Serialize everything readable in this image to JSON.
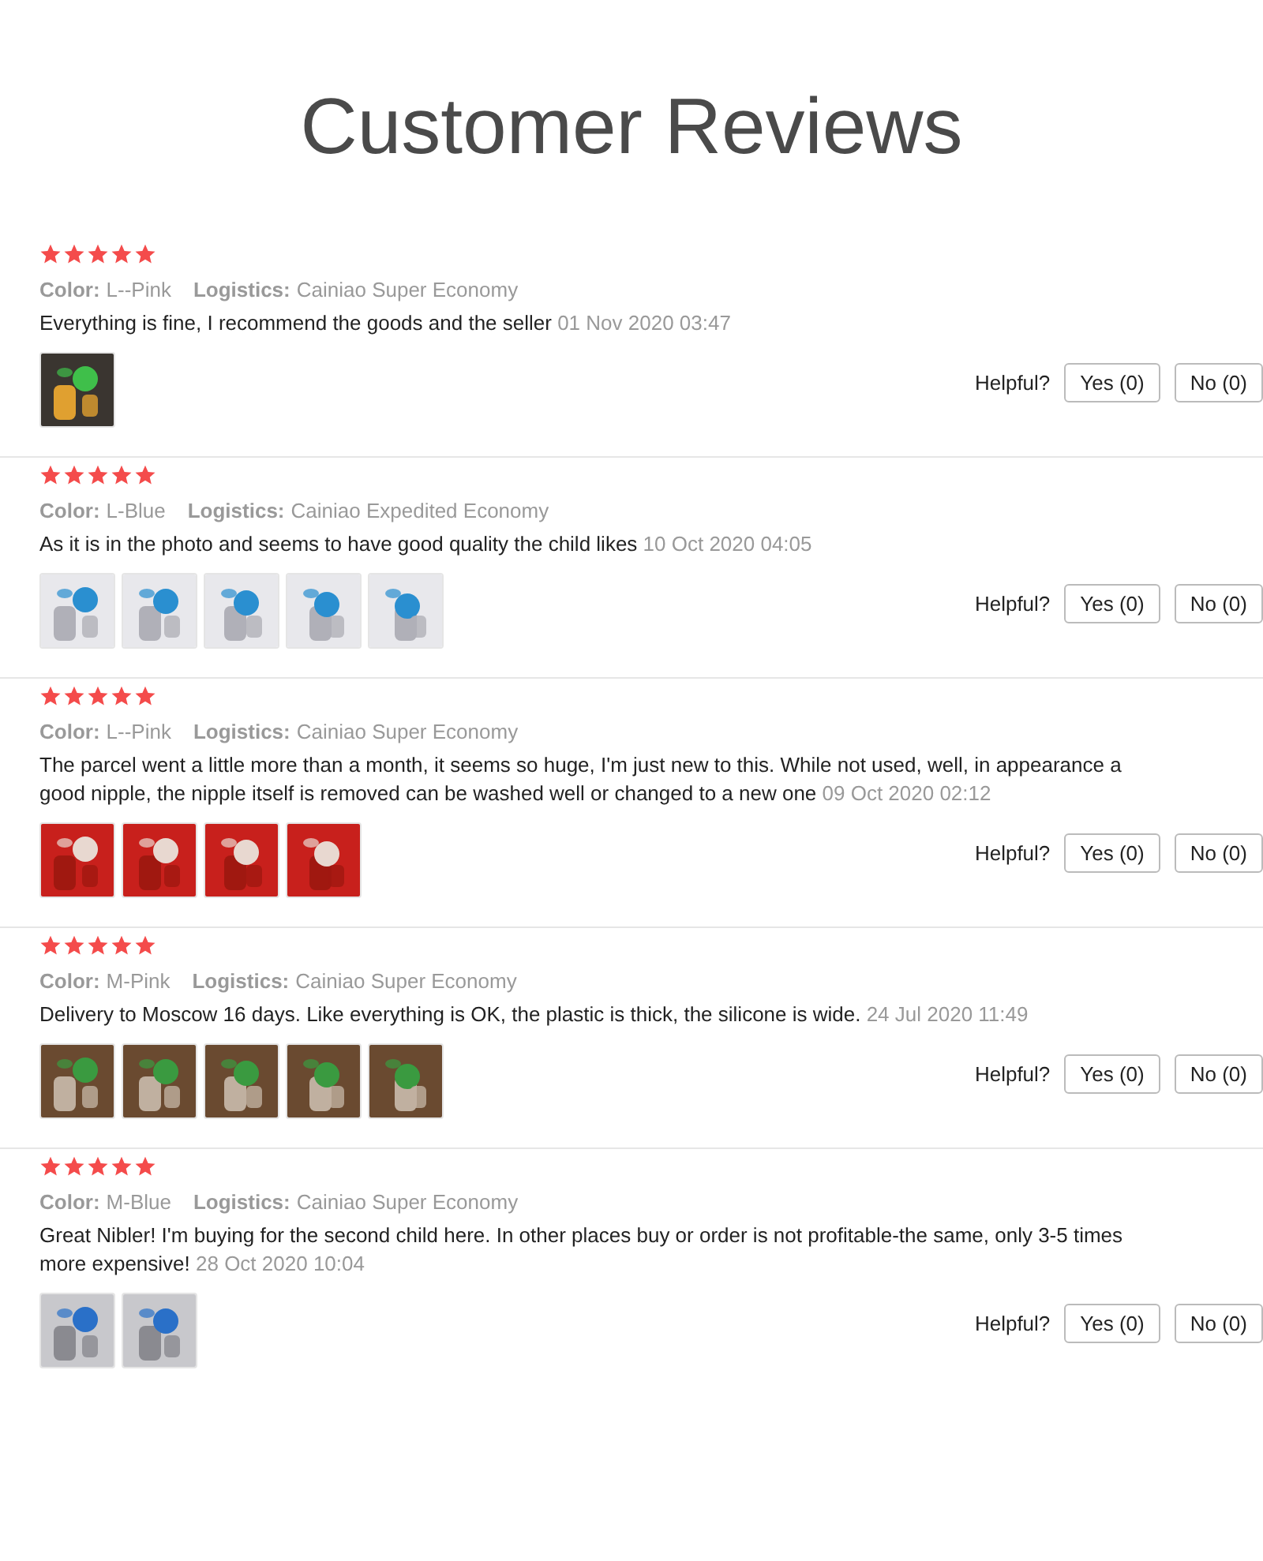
{
  "title": "Customer Reviews",
  "reviews": [
    {
      "stars": 5,
      "color_label": "Color:",
      "variant": "L--Pink",
      "logistics_label": "Logistics:",
      "logistics": "Cainiao Super Economy",
      "comment": "Everything is fine, I recommend the goods and the seller",
      "date": "01 Nov 2020 03:47",
      "photos": [
        {
          "kind": "picture"
        }
      ],
      "helpful_label": "Helpful?",
      "yes": "Yes (0)",
      "no": "No (0)"
    },
    {
      "stars": 5,
      "color_label": "Color:",
      "variant": "L-Blue",
      "logistics_label": "Logistics:",
      "logistics": "Cainiao Expedited Economy",
      "comment": "As it is in the photo and seems to have good quality the child likes",
      "date": "10 Oct 2020 04:05",
      "photos": [
        {
          "kind": "picture"
        },
        {
          "kind": "picture"
        },
        {
          "kind": "picture"
        },
        {
          "kind": "picture"
        },
        {
          "kind": "picture"
        }
      ],
      "helpful_label": "Helpful?",
      "yes": "Yes (0)",
      "no": "No (0)"
    },
    {
      "stars": 5,
      "color_label": "Color:",
      "variant": "L--Pink",
      "logistics_label": "Logistics:",
      "logistics": "Cainiao Super Economy",
      "comment": "The parcel went a little more than a month, it seems so huge, I'm just new to this. While not used, well, in appearance a good nipple, the nipple itself is removed can be washed well or changed to a new one",
      "date": "09 Oct 2020 02:12",
      "photos": [
        {
          "kind": "picture"
        },
        {
          "kind": "picture"
        },
        {
          "kind": "picture"
        },
        {
          "kind": "picture"
        }
      ],
      "helpful_label": "Helpful?",
      "yes": "Yes (0)",
      "no": "No (0)"
    },
    {
      "stars": 5,
      "color_label": "Color:",
      "variant": "M-Pink",
      "logistics_label": "Logistics:",
      "logistics": "Cainiao Super Economy",
      "comment": "Delivery to Moscow 16 days. Like everything is OK, the plastic is thick, the silicone is wide.",
      "date": "24 Jul 2020 11:49",
      "photos": [
        {
          "kind": "picture"
        },
        {
          "kind": "picture"
        },
        {
          "kind": "picture"
        },
        {
          "kind": "picture"
        },
        {
          "kind": "picture"
        }
      ],
      "helpful_label": "Helpful?",
      "yes": "Yes (0)",
      "no": "No (0)"
    },
    {
      "stars": 5,
      "color_label": "Color:",
      "variant": "M-Blue",
      "logistics_label": "Logistics:",
      "logistics": "Cainiao Super Economy",
      "comment": "Great Nibler! I'm buying for the second child here. In other places buy or order is not profitable-the same, only 3-5 times more expensive!",
      "date": "28 Oct 2020 10:04",
      "photos": [
        {
          "kind": "picture"
        },
        {
          "kind": "picture"
        }
      ],
      "helpful_label": "Helpful?",
      "yes": "Yes (0)",
      "no": "No (0)"
    }
  ]
}
